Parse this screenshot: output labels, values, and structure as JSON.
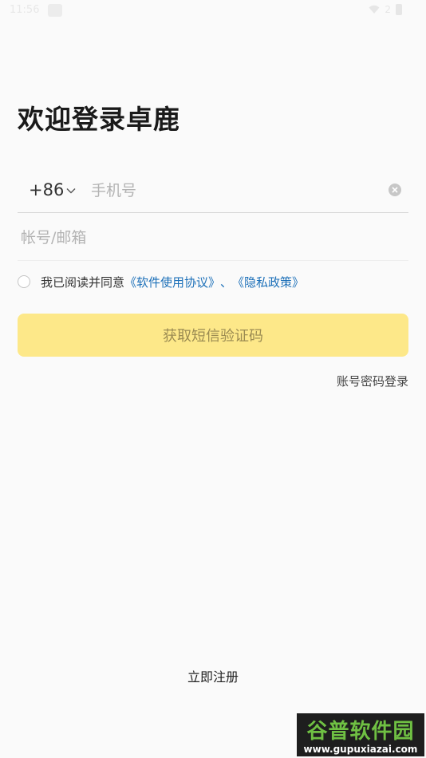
{
  "status_bar": {
    "time": "11:56",
    "signal_text": "2"
  },
  "title": "欢迎登录卓鹿",
  "phone": {
    "country_code": "+86",
    "placeholder": "手机号"
  },
  "account": {
    "placeholder": "帐号/邮箱"
  },
  "agreement": {
    "prefix": "我已阅读并同意",
    "software_link": "《软件使用协议》",
    "separator": "、",
    "privacy_link": "《隐私政策》"
  },
  "sms_button_label": "获取短信验证码",
  "password_login_label": "账号密码登录",
  "register_label": "立即注册",
  "watermark": {
    "logo_text": "谷普软件园",
    "url": "www.gupuxiazai.com"
  },
  "colors": {
    "accent_yellow": "#fde889",
    "link_blue": "#1b6fb8",
    "background": "#fafafa"
  }
}
